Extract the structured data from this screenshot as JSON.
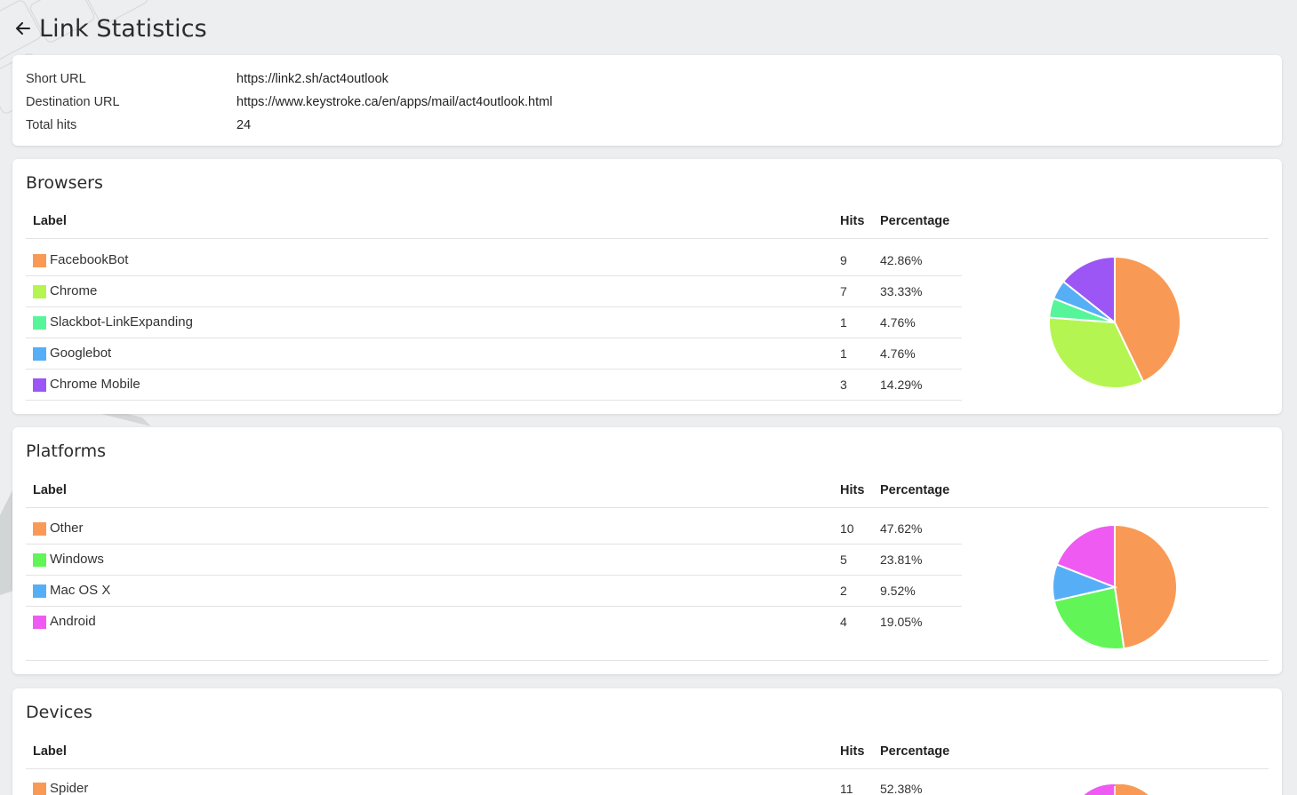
{
  "header": {
    "title": "Link Statistics"
  },
  "info": {
    "short_url_label": "Short URL",
    "short_url_value": "https://link2.sh/act4outlook",
    "destination_url_label": "Destination URL",
    "destination_url_value": "https://www.keystroke.ca/en/apps/mail/act4outlook.html",
    "total_hits_label": "Total hits",
    "total_hits_value": "24"
  },
  "table_headers": {
    "label": "Label",
    "hits": "Hits",
    "percentage": "Percentage"
  },
  "sections": [
    {
      "title": "Browsers",
      "rows": [
        {
          "label": "FacebookBot",
          "hits": "9",
          "percentage": "42.86%",
          "color": "#f89a56"
        },
        {
          "label": "Chrome",
          "hits": "7",
          "percentage": "33.33%",
          "color": "#b5f551"
        },
        {
          "label": "Slackbot-LinkExpanding",
          "hits": "1",
          "percentage": "4.76%",
          "color": "#57f59a"
        },
        {
          "label": "Googlebot",
          "hits": "1",
          "percentage": "4.76%",
          "color": "#56aff6"
        },
        {
          "label": "Chrome Mobile",
          "hits": "3",
          "percentage": "14.29%",
          "color": "#9b56f5"
        }
      ]
    },
    {
      "title": "Platforms",
      "rows": [
        {
          "label": "Other",
          "hits": "10",
          "percentage": "47.62%",
          "color": "#f89a56"
        },
        {
          "label": "Windows",
          "hits": "5",
          "percentage": "23.81%",
          "color": "#62f558"
        },
        {
          "label": "Mac OS X",
          "hits": "2",
          "percentage": "9.52%",
          "color": "#56aff6"
        },
        {
          "label": "Android",
          "hits": "4",
          "percentage": "19.05%",
          "color": "#ef5bf2"
        }
      ]
    },
    {
      "title": "Devices",
      "rows": [
        {
          "label": "Spider",
          "hits": "11",
          "percentage": "52.38%",
          "color": "#f89a56"
        }
      ]
    }
  ],
  "chart_data": [
    {
      "type": "pie",
      "categories": [
        "FacebookBot",
        "Chrome",
        "Slackbot-LinkExpanding",
        "Googlebot",
        "Chrome Mobile"
      ],
      "values": [
        9,
        7,
        1,
        1,
        3
      ],
      "colors": [
        "#f89a56",
        "#b5f551",
        "#57f59a",
        "#56aff6",
        "#9b56f5"
      ]
    },
    {
      "type": "pie",
      "categories": [
        "Other",
        "Windows",
        "Mac OS X",
        "Android"
      ],
      "values": [
        10,
        5,
        2,
        4
      ],
      "colors": [
        "#f89a56",
        "#62f558",
        "#56aff6",
        "#ef5bf2"
      ]
    },
    {
      "type": "pie",
      "categories": [
        "Spider"
      ],
      "values": [
        11
      ],
      "colors": [
        "#f89a56",
        "#ef5bf2"
      ]
    }
  ]
}
